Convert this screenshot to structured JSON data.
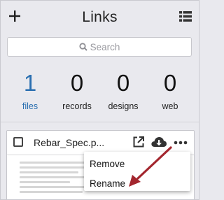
{
  "header": {
    "title": "Links",
    "add_icon": "plus-icon",
    "list_icon": "list-view-icon"
  },
  "search": {
    "placeholder": "Search",
    "icon": "search-icon"
  },
  "stats": [
    {
      "value": "1",
      "label": "files"
    },
    {
      "value": "0",
      "label": "records"
    },
    {
      "value": "0",
      "label": "designs"
    },
    {
      "value": "0",
      "label": "web"
    }
  ],
  "file_card": {
    "name": "Rebar_Spec.p...",
    "icons": [
      "open-external-icon",
      "cloud-download-icon",
      "more-options-icon"
    ]
  },
  "context_menu": {
    "items": [
      "Remove",
      "Rename"
    ]
  },
  "colors": {
    "accent": "#2a6fb0",
    "annotation_arrow": "#a3262e"
  }
}
